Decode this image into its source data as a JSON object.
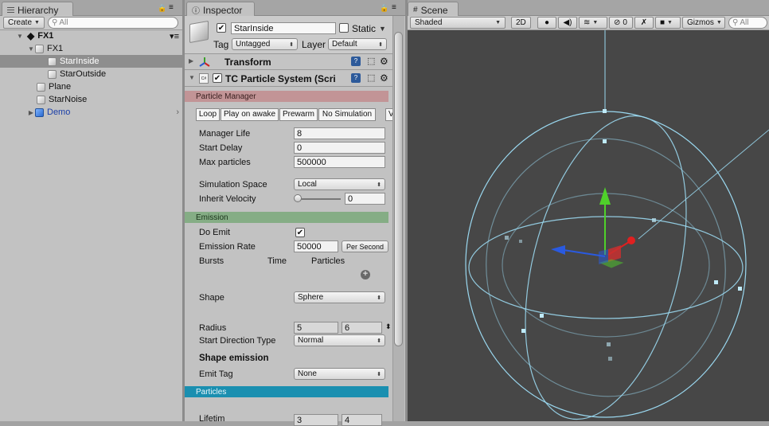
{
  "hierarchy": {
    "tab_label": "Hierarchy",
    "create_label": "Create",
    "search_placeholder": "All",
    "scene_name": "FX1",
    "items": [
      {
        "label": "FX1"
      },
      {
        "label": "StarInside"
      },
      {
        "label": "StarOutside"
      },
      {
        "label": "Plane"
      },
      {
        "label": "StarNoise"
      },
      {
        "label": "Demo"
      }
    ]
  },
  "inspector": {
    "tab_label": "Inspector",
    "object_name": "StarInside",
    "static_label": "Static",
    "tag_label": "Tag",
    "tag_value": "Untagged",
    "layer_label": "Layer",
    "layer_value": "Default",
    "transform_label": "Transform",
    "component_label": "TC Particle System (Scri",
    "sections": {
      "manager": "Particle Manager",
      "emission": "Emission",
      "particles": "Particles"
    },
    "toggles": [
      "Loop",
      "Play on awake",
      "Prewarm",
      "No Simulation"
    ],
    "fields": {
      "manager_life": {
        "label": "Manager Life",
        "value": "8"
      },
      "start_delay": {
        "label": "Start Delay",
        "value": "0"
      },
      "max_particles": {
        "label": "Max particles",
        "value": "500000"
      },
      "simulation_space": {
        "label": "Simulation Space",
        "value": "Local"
      },
      "inherit_velocity": {
        "label": "Inherit Velocity",
        "value": "0",
        "level": 0
      },
      "do_emit": {
        "label": "Do Emit"
      },
      "emission_rate": {
        "label": "Emission Rate",
        "value": "50000",
        "unit": "Per Second"
      },
      "bursts": {
        "label": "Bursts",
        "time": "Time",
        "particles": "Particles"
      },
      "shape": {
        "label": "Shape",
        "value": "Sphere"
      },
      "radius": {
        "label": "Radius",
        "min": "5",
        "max": "6"
      },
      "start_direction": {
        "label": "Start Direction Type",
        "value": "Normal"
      },
      "shape_emission": {
        "label": "Shape emission"
      },
      "emit_tag": {
        "label": "Emit Tag",
        "value": "None"
      },
      "lifetime": {
        "label": "Lifetim",
        "min": "3",
        "max": "4"
      }
    }
  },
  "scene": {
    "tab_label": "Scene",
    "shading_mode": "Shaded",
    "mode_2d": "2D",
    "hidden_count": "0",
    "gizmos_label": "Gizmos",
    "search_placeholder": "All"
  },
  "colors": {
    "scene_bg": "#474747",
    "gizmo_wire": "#9ad8f0",
    "manager_section": "#c29496",
    "emission_section": "#85ad85",
    "particles_section": "#1a8fb0",
    "y_axis": "#4fd12a",
    "x_axis": "#e02020",
    "z_axis": "#2a5ae0"
  }
}
